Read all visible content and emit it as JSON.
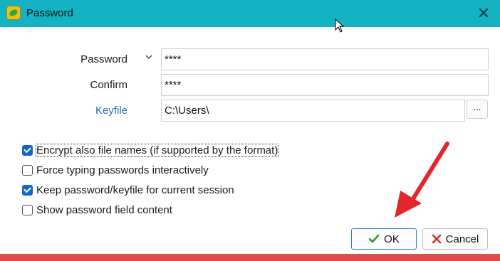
{
  "window": {
    "title": "Password",
    "close_glyph": "✕"
  },
  "form": {
    "password_label": "Password",
    "password_value": "****",
    "confirm_label": "Confirm",
    "confirm_value": "****",
    "keyfile_label": "Keyfile",
    "keyfile_value": "C:\\Users\\",
    "browse_label": "..."
  },
  "options": [
    {
      "label": "Encrypt also file names (if supported by the format)",
      "checked": true
    },
    {
      "label": "Force typing passwords interactively",
      "checked": false
    },
    {
      "label": "Keep password/keyfile for current session",
      "checked": true
    },
    {
      "label": "Show password field content",
      "checked": false
    }
  ],
  "buttons": {
    "ok_label": "OK",
    "cancel_label": "Cancel"
  },
  "colors": {
    "titlebar": "#14b3c3",
    "accent": "#1466c5",
    "link": "#2a6ebb",
    "annotation_arrow": "#e3262b",
    "bottom_bar": "#e14b4b"
  }
}
